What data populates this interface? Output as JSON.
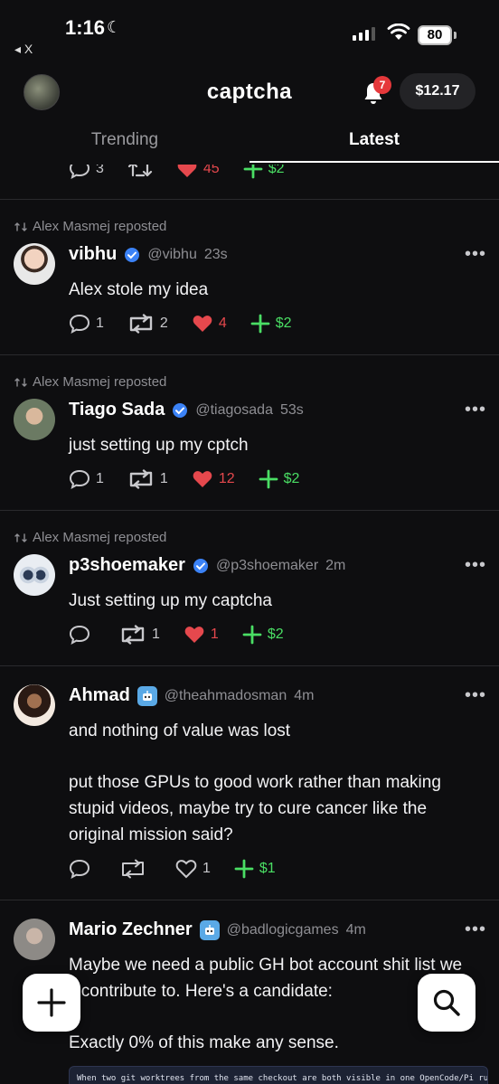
{
  "status_bar": {
    "time": "1:16",
    "back_label": "◂ X",
    "battery": "80"
  },
  "header": {
    "title": "captcha",
    "notification_count": "7",
    "balance": "$12.17"
  },
  "tabs": [
    {
      "label": "Trending"
    },
    {
      "label": "Latest"
    }
  ],
  "partial_post": {
    "replies": "3",
    "likes": "45",
    "tip": "$2"
  },
  "posts": [
    {
      "repost_by": "Alex Masmej reposted",
      "name": "vibhu",
      "handle": "@vibhu",
      "age": "23s",
      "text": "Alex stole my idea",
      "replies": "1",
      "reposts": "2",
      "likes": "4",
      "tip": "$2"
    },
    {
      "repost_by": "Alex Masmej reposted",
      "name": "Tiago Sada",
      "handle": "@tiagosada",
      "age": "53s",
      "text": "just setting up my cptch",
      "replies": "1",
      "reposts": "1",
      "likes": "12",
      "tip": "$2"
    },
    {
      "repost_by": "Alex Masmej reposted",
      "name": "p3shoemaker",
      "handle": "@p3shoemaker",
      "age": "2m",
      "text": "Just setting up my captcha",
      "replies": "",
      "reposts": "1",
      "likes": "1",
      "tip": "$2"
    },
    {
      "name": "Ahmad",
      "handle": "@theahmadosman",
      "age": "4m",
      "text_line1": "and nothing of value was lost",
      "text_line2": "put those GPUs to good work rather than making stupid videos, maybe try to cure cancer like the original mission said?",
      "replies": "",
      "reposts": "",
      "likes": "1",
      "tip": "$1"
    },
    {
      "name": "Mario Zechner",
      "handle": "@badlogicgames",
      "age": "4m",
      "text_line1": "Maybe we need a public GH bot account shit list we",
      "text_line2": "ll contribute to. Here's a candidate:",
      "text_line3": "Exactly 0% of this make any sense.",
      "code_snippet": "When two git worktrees from the same checkout are both visible in one OpenCode/Pi runtime session, project-local"
    }
  ]
}
